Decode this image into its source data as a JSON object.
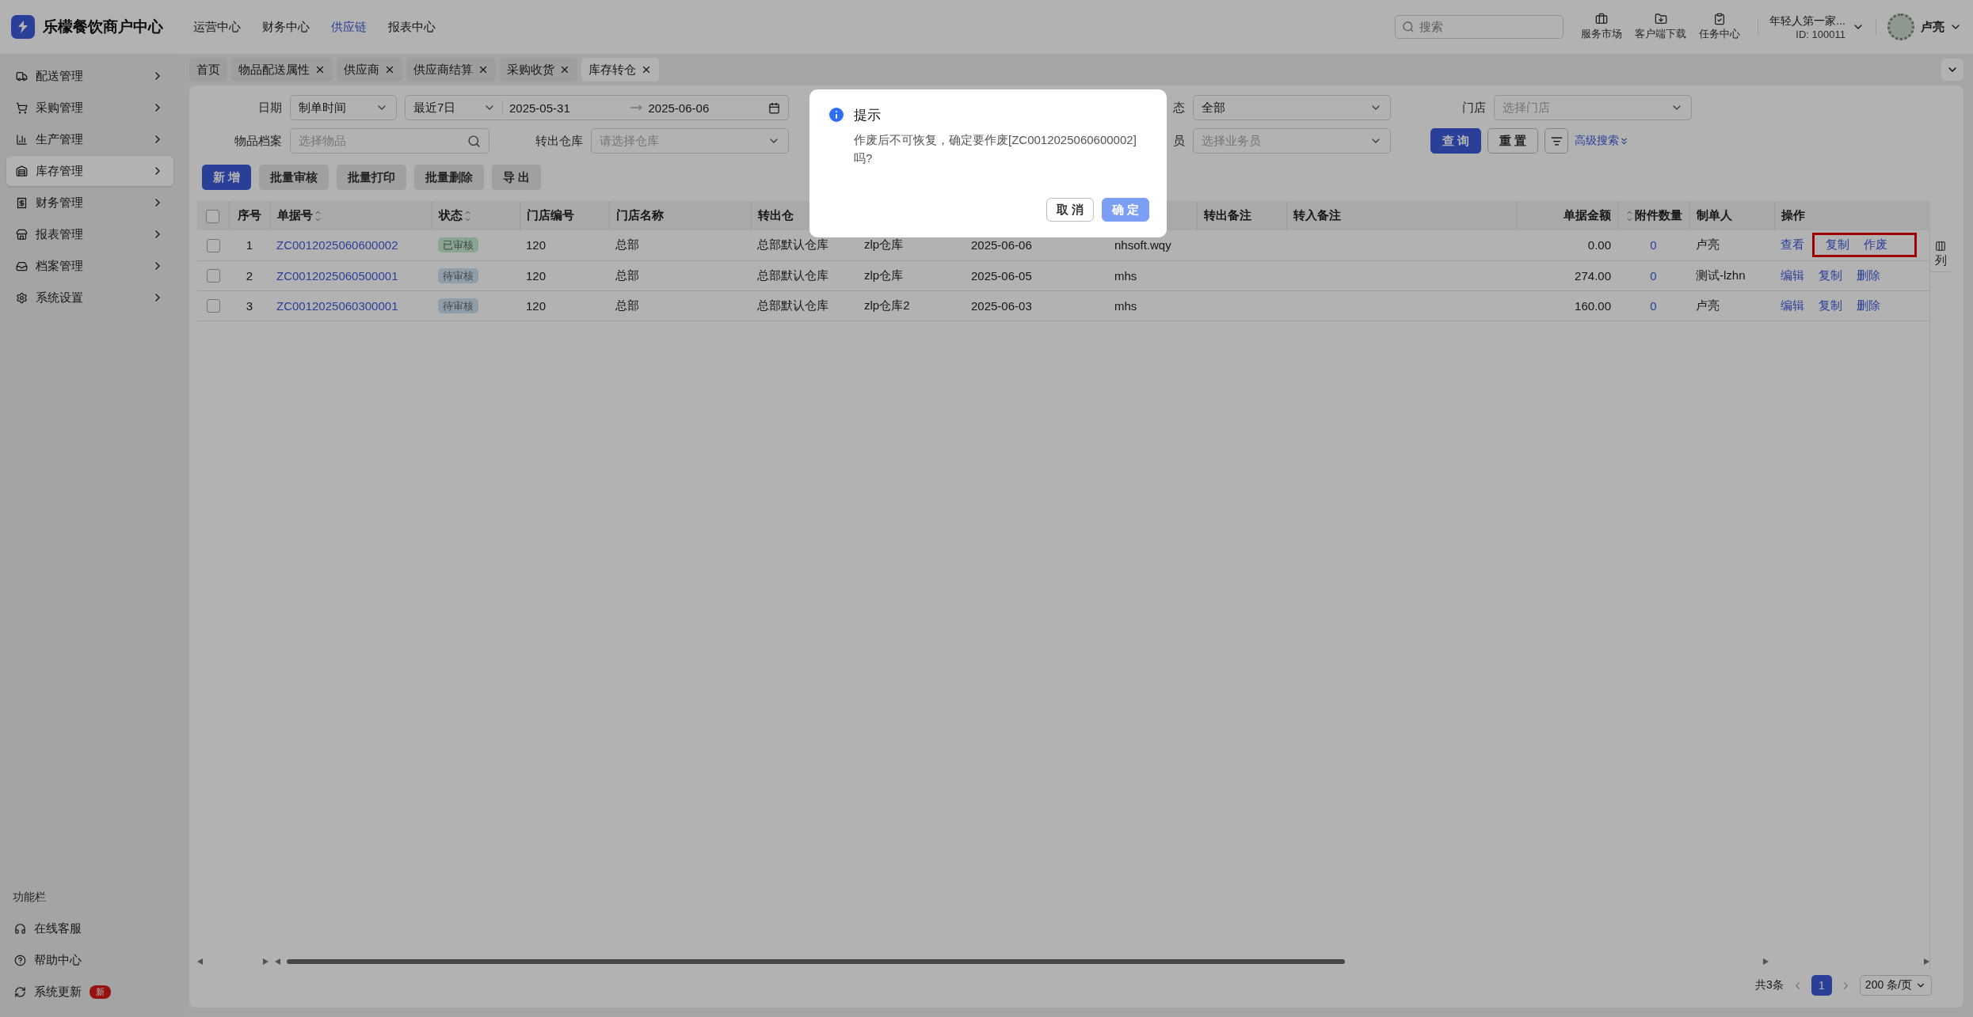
{
  "app": {
    "title": "乐檬餐饮商户中心"
  },
  "nav": [
    {
      "label": "运营中心",
      "selected": false
    },
    {
      "label": "财务中心",
      "selected": false
    },
    {
      "label": "供应链",
      "selected": true
    },
    {
      "label": "报表中心",
      "selected": false
    }
  ],
  "search": {
    "placeholder": "搜索"
  },
  "tools": [
    {
      "label": "服务市场"
    },
    {
      "label": "客户端下载"
    },
    {
      "label": "任务中心"
    }
  ],
  "store": {
    "name": "年轻人第一家...",
    "id": "ID: 100011"
  },
  "user": {
    "name": "卢亮"
  },
  "sidebar": {
    "items": [
      {
        "label": "配送管理",
        "selected": false
      },
      {
        "label": "采购管理",
        "selected": false
      },
      {
        "label": "生产管理",
        "selected": false
      },
      {
        "label": "库存管理",
        "selected": true
      },
      {
        "label": "财务管理",
        "selected": false
      },
      {
        "label": "报表管理",
        "selected": false
      },
      {
        "label": "档案管理",
        "selected": false
      },
      {
        "label": "系统设置",
        "selected": false
      }
    ],
    "footer_title": "功能栏",
    "footer_items": [
      {
        "label": "在线客服"
      },
      {
        "label": "帮助中心"
      },
      {
        "label": "系统更新",
        "badge": "新"
      }
    ]
  },
  "tabs": [
    {
      "label": "首页",
      "closable": false,
      "selected": false
    },
    {
      "label": "物品配送属性",
      "closable": true,
      "selected": false
    },
    {
      "label": "供应商",
      "closable": true,
      "selected": false
    },
    {
      "label": "供应商结算",
      "closable": true,
      "selected": false
    },
    {
      "label": "采购收货",
      "closable": true,
      "selected": false
    },
    {
      "label": "库存转仓",
      "closable": true,
      "selected": true
    }
  ],
  "filters": [
    {
      "label": "日期",
      "kind": "date",
      "mode": "制单时间",
      "preset": "最近7日",
      "start": "2025-05-31",
      "end": "2025-06-06"
    },
    {
      "label": "态",
      "kind": "select",
      "value": "全部"
    },
    {
      "label": "门店",
      "kind": "select",
      "placeholder": "选择门店"
    },
    {
      "label": "物品档案",
      "kind": "search",
      "placeholder": "选择物品"
    },
    {
      "label": "转出仓库",
      "kind": "select",
      "placeholder": "请选择仓库"
    },
    {
      "label": "员",
      "kind": "select",
      "placeholder": "选择业务员"
    }
  ],
  "filter_buttons": {
    "query": "查 询",
    "reset": "重 置",
    "advanced": "高级搜索"
  },
  "actions": [
    {
      "label": "新 增",
      "primary": true
    },
    {
      "label": "批量审核",
      "primary": false
    },
    {
      "label": "批量打印",
      "primary": false
    },
    {
      "label": "批量删除",
      "primary": false
    },
    {
      "label": "导 出",
      "primary": false
    }
  ],
  "table": {
    "all_checked": false,
    "columns": [
      {
        "label": "序号",
        "sortable": false
      },
      {
        "label": "单据号",
        "sortable": true
      },
      {
        "label": "状态",
        "sortable": true
      },
      {
        "label": "门店编号",
        "sortable": false
      },
      {
        "label": "门店名称",
        "sortable": false
      },
      {
        "label": "转出仓",
        "sortable": false
      },
      null,
      null,
      null,
      {
        "label": "转出备注",
        "sortable": false
      },
      {
        "label": "转入备注",
        "sortable": false
      },
      {
        "label": "单据金额",
        "sortable": false
      },
      {
        "label": "附件数量",
        "sortable": true
      },
      {
        "label": "制单人",
        "sortable": false
      },
      {
        "label": "操作",
        "sortable": false
      }
    ],
    "rows": [
      {
        "checked": false,
        "cells": [
          "1",
          "ZC0012025060600002",
          "已审核",
          "120",
          "总部",
          "总部默认仓库",
          "zlp仓库",
          "2025-06-06",
          "nhsoft.wqy",
          "",
          "",
          "0.00",
          "0",
          "卢亮"
        ],
        "color": "#8ba594",
        "actions": [
          {
            "label": "查看",
            "highlighted": false
          },
          {
            "label": "复制",
            "highlighted": true
          },
          {
            "label": "作废",
            "highlighted": true
          }
        ]
      },
      {
        "checked": false,
        "cells": [
          "2",
          "ZC0012025060500001",
          "待审核",
          "120",
          "总部",
          "总部默认仓库",
          "zlp仓库",
          "2025-06-05",
          "mhs",
          "",
          "",
          "274.00",
          "0",
          "测试-lzhn"
        ],
        "color": "#919fab",
        "actions": [
          {
            "label": "编辑",
            "highlighted": false
          },
          {
            "label": "复制",
            "highlighted": false
          },
          {
            "label": "删除",
            "highlighted": false
          }
        ]
      },
      {
        "checked": false,
        "cells": [
          "3",
          "ZC0012025060300001",
          "待审核",
          "120",
          "总部",
          "总部默认仓库",
          "zlp仓库2",
          "2025-06-03",
          "mhs",
          "",
          "",
          "160.00",
          "0",
          "卢亮"
        ],
        "color": "#919fab",
        "actions": [
          {
            "label": "编辑",
            "highlighted": false
          },
          {
            "label": "复制",
            "highlighted": false
          },
          {
            "label": "删除",
            "highlighted": false
          }
        ]
      }
    ]
  },
  "column_settings": {
    "label": "列"
  },
  "pagination": {
    "total": "共3条",
    "page": "1",
    "page_size": "200 条/页"
  },
  "modal": {
    "title": "提示",
    "message": "作废后不可恢复，确定要作废[ZC0012025060600002]吗?",
    "cancel": "取 消",
    "ok": "确 定"
  }
}
